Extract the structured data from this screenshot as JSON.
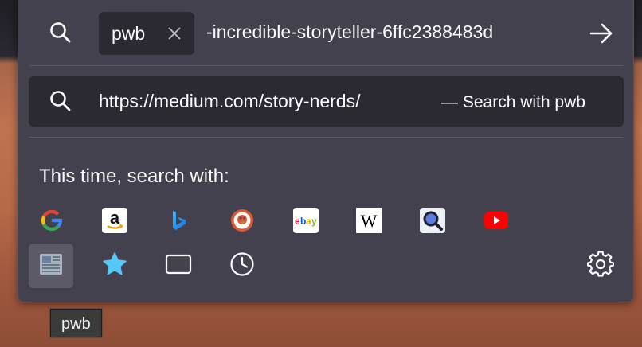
{
  "urlbar": {
    "engine_chip": "pwb",
    "typed_text": "-incredible-storyteller-6ffc2388483d"
  },
  "result": {
    "url": "https://medium.com/story-nerds/",
    "action": "— Search with pwb"
  },
  "one_off": {
    "heading": "This time, search with:",
    "engines": [
      {
        "name": "Google",
        "icon": "google-icon"
      },
      {
        "name": "Amazon",
        "icon": "amazon-icon"
      },
      {
        "name": "Bing",
        "icon": "bing-icon"
      },
      {
        "name": "DuckDuckGo",
        "icon": "duckduckgo-icon"
      },
      {
        "name": "eBay",
        "icon": "ebay-icon"
      },
      {
        "name": "Wikipedia",
        "icon": "wikipedia-icon"
      },
      {
        "name": "Search engine",
        "icon": "magnifier-engine-icon"
      },
      {
        "name": "YouTube",
        "icon": "youtube-icon"
      }
    ],
    "modes": [
      {
        "name": "pwb",
        "icon": "pwb-engine-icon",
        "active": true
      },
      {
        "name": "Bookmarks",
        "icon": "star-icon"
      },
      {
        "name": "Tabs",
        "icon": "tab-icon"
      },
      {
        "name": "History",
        "icon": "clock-icon"
      }
    ],
    "settings_icon": "gear-icon"
  },
  "tooltip": {
    "text": "pwb"
  },
  "colors": {
    "panel": "#42414d",
    "field": "#2b2a33",
    "text": "#fbfbfe",
    "divider": "#5b5a66",
    "star": "#54c8f9"
  }
}
